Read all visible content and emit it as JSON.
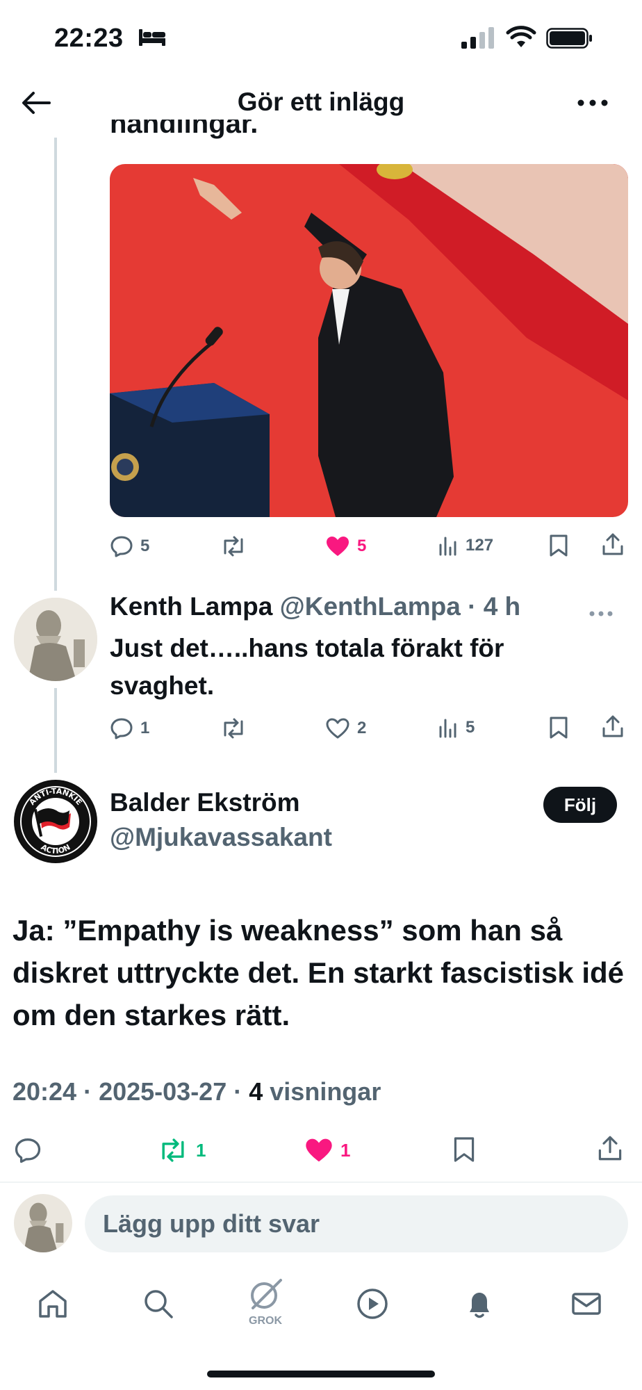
{
  "status_bar": {
    "time": "22:23"
  },
  "header": {
    "title": "Gör ett inlägg"
  },
  "previous_post": {
    "clipped_text": "handlingar.",
    "actions": {
      "replies": "5",
      "likes": "5",
      "views": "127"
    }
  },
  "reply_post": {
    "name": "Kenth Lampa",
    "handle": "@KenthLampa",
    "time": "4 h",
    "text": "Just det…..hans totala förakt för svaghet.",
    "actions": {
      "replies": "1",
      "likes": "2",
      "views": "5"
    }
  },
  "main_post": {
    "name": "Balder Ekström",
    "handle": "@Mjukavassakant",
    "follow_label": "Följ",
    "avatar_text_top": "ANTI-TANKIE",
    "avatar_text_bottom": "ACTION",
    "text": "Ja: ”Empathy is weakness” som han så diskret uttryckte det. En starkt fascistisk idé om den starkes rätt.",
    "meta": {
      "time": "20:24",
      "date": "2025-03-27",
      "views_count": "4",
      "views_label": "visningar"
    },
    "actions": {
      "reposts": "1",
      "likes": "1"
    }
  },
  "reply_box": {
    "placeholder": "Lägg upp ditt svar"
  },
  "bottom_nav": {
    "grok_label": "GROK"
  },
  "colors": {
    "like_pink": "#f91880",
    "repost_green": "#00ba7c",
    "icon_gray": "#536471",
    "text_dark": "#0f1419"
  }
}
